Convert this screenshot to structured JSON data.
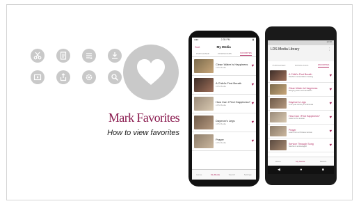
{
  "slide": {
    "title": "Mark Favorites",
    "subtitle": "How to view favorites"
  },
  "icons": [
    "scissors-icon",
    "document-icon",
    "list-icon",
    "download-icon",
    "video-icon",
    "share-icon",
    "gear-icon",
    "search-icon"
  ],
  "colors": {
    "accent": "#8a1b4f",
    "icon_bg": "#c9c9c9"
  },
  "iphone": {
    "status_time": "2:35 PM",
    "back_label": "Sort",
    "title": "My Media",
    "tabs": [
      "PURCHASED",
      "DOWNLOADS",
      "FAVORITES"
    ],
    "rows": [
      {
        "title": "Clean Water Is Happiness",
        "sub": "LDS Media"
      },
      {
        "title": "A Child's First Breath",
        "sub": "LDS Media"
      },
      {
        "title": "How Can I Find Happiness?",
        "sub": "LDS Media"
      },
      {
        "title": "Daymon's Legs",
        "sub": "LDS Media"
      },
      {
        "title": "Prayer",
        "sub": "LDS Media"
      }
    ],
    "tabbar": [
      "Home",
      "My Media",
      "Search",
      "Settings"
    ]
  },
  "android": {
    "status": "12:30",
    "title": "LDS Media Library",
    "tabs": [
      "PURCHASED",
      "DOWNLOADS",
      "FAVORITES"
    ],
    "rows": [
      {
        "title": "A Child's First Breath",
        "sub": "Newborn resuscitation training"
      },
      {
        "title": "Clean Water is Happiness",
        "sub": "Bringing water and sanitation"
      },
      {
        "title": "Daymon's Legs",
        "sub": "A 12-year-old boy in Indonesia"
      },
      {
        "title": "How Can I Find Happiness?",
        "sub": "Listen to the answer"
      },
      {
        "title": "Prayer",
        "sub": "Learn from a Chinese woman"
      },
      {
        "title": "Service Through Song",
        "sub": "Service is encouraged"
      }
    ],
    "bottom": [
      "Home",
      "My Media",
      "Search"
    ]
  }
}
